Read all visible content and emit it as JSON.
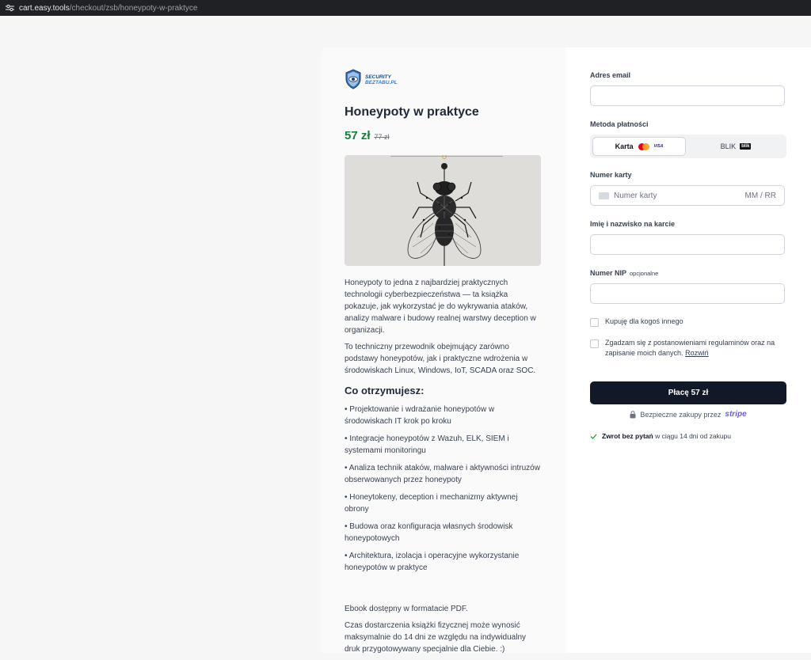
{
  "browser": {
    "url_host": "cart.easy.tools",
    "url_path": "/checkout/zsb/honeypoty-w-praktyce"
  },
  "brand": {
    "logo_line1": "SECURITY",
    "logo_line2": "BEZTABU.PL"
  },
  "product": {
    "title": "Honeypoty w praktyce",
    "price": "57 zł",
    "old_price": "77 zł",
    "description": [
      "Honeypoty to jedna z najbardziej praktycznych technologii cyberbezpieczeństwa — ta książka pokazuje, jak wykorzystać je do wykrywania ataków, analizy malware i budowy realnej warstwy deception w organizacji.",
      "To techniczny przewodnik obejmujący zarówno podstawy honeypotów, jak i praktyczne wdrożenia w środowiskach Linux, Windows, IoT, SCADA oraz SOC."
    ],
    "benefits_heading": "Co otrzymujesz:",
    "benefits": [
      "• Projektowanie i wdrażanie honeypotów w środowiskach IT krok po kroku",
      "• Integracje honeypotów z Wazuh, ELK, SIEM i systemami monitoringu",
      "• Analiza technik ataków, malware i aktywności intruzów obserwowanych przez honeypoty",
      "• Honeytokeny, deception i mechanizmy aktywnej obrony",
      "• Budowa oraz konfiguracja własnych środowisk honeypotowych",
      "• Architektura, izolacja i operacyjne wykorzystanie honeypotów w praktyce"
    ],
    "footer_notes": [
      "Ebook dostępny w formatacie PDF.",
      "Czas dostarczenia książki fizycznej może wynosić maksymalnie do 14 dni ze względu na indywidualny druk przygotowywany specjalnie dla Ciebie. :)"
    ]
  },
  "form": {
    "email_label": "Adres email",
    "email_value": "",
    "payment_method_label": "Metoda płatności",
    "method_card": "Karta",
    "card_brand_visa": "VISA",
    "method_blik": "BLIK",
    "blik_badge": "blik",
    "card_number_label": "Numer karty",
    "card_number_placeholder": "Numer karty",
    "expiry_placeholder": "MM / RR",
    "cardholder_label": "Imię i nazwisko na karcie",
    "cardholder_value": "",
    "nip_label": "Numer NIP",
    "nip_optional": "opcjonalne",
    "nip_value": "",
    "gift_label": "Kupuję dla kogoś innego",
    "terms_label": "Zgadzam się z postanowieniami regulaminów oraz na zapisanie moich danych.",
    "terms_expand": "Rozwiń",
    "pay_button": "Płacę 57 zł",
    "secure_text": "Bezpieczne zakupy przez",
    "secure_brand": "stripe",
    "refund_bold": "Zwrot bez pytań",
    "refund_text": "w ciągu 14 dni od zakupu"
  },
  "colors": {
    "price_green": "#15803d",
    "pay_button_bg": "#111827",
    "stripe_purple": "#635bff"
  }
}
